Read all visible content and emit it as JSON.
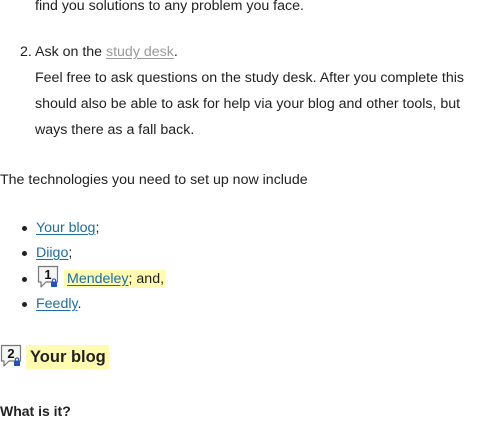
{
  "list_top": {
    "item1_tail": "find you solutions to any problem you face.",
    "item2": {
      "number": "2.",
      "lead": "Ask on the ",
      "link": "study desk",
      "lead_end": ".",
      "line1": "Feel free to ask questions on the study desk. After you complete this",
      "line2": "should also be able to ask for help via your blog and other tools, but",
      "line3": "ways there as a fall back."
    }
  },
  "intro": "The technologies you need to set up now include",
  "tech_list": [
    {
      "link": "Your blog",
      "suffix": ";"
    },
    {
      "link": "Diigo",
      "suffix": ";"
    },
    {
      "badge": "1",
      "link": "Mendeley",
      "suffix": "; and,"
    },
    {
      "link": "Feedly",
      "suffix": "."
    }
  ],
  "section": {
    "badge": "2",
    "heading": "Your blog",
    "subheading": "What is it?"
  },
  "colors": {
    "link": "#1a6fa3",
    "visited_link": "#9a9a9a",
    "highlight": "#fffbb0",
    "badge_lock": "#1f4fc9"
  },
  "icons": {
    "note_badge": "comment-note-icon",
    "lock": "lock-icon"
  }
}
